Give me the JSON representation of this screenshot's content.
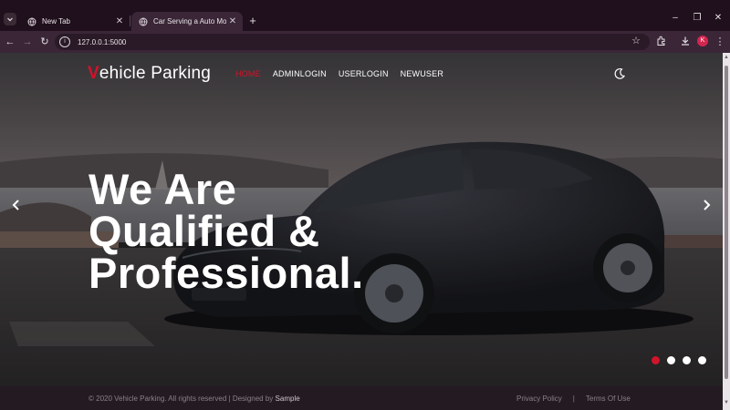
{
  "browser": {
    "tabs": [
      {
        "title": "New Tab",
        "active": false
      },
      {
        "title": "Car Serving a Auto Mobile Cat",
        "active": true
      }
    ],
    "url": "127.0.0.1:5000",
    "profile_initial": "K"
  },
  "site": {
    "brand_first": "V",
    "brand_rest": "ehicle Parking",
    "nav": [
      {
        "label": "HOME",
        "active": true
      },
      {
        "label": "ADMINLOGIN",
        "active": false
      },
      {
        "label": "USERLOGIN",
        "active": false
      },
      {
        "label": "NEWUSER",
        "active": false
      }
    ],
    "hero": {
      "line1": "We Are",
      "line2": "Qualified &",
      "line3": "Professional."
    },
    "carousel": {
      "slides": 4,
      "active_index": 0
    },
    "footer": {
      "copyright": "© 2020 Vehicle Parking. All rights reserved | Designed by",
      "designer": "Sample",
      "links": [
        "Privacy Policy",
        "|",
        "Terms Of Use"
      ]
    }
  },
  "colors": {
    "accent": "#d0142c",
    "tab_bar": "#200f1c",
    "toolbar": "#3a2637"
  },
  "icons": [
    "tab-search-icon",
    "globe-icon",
    "close-icon",
    "plus-icon",
    "minimize-icon",
    "maximize-icon",
    "back-icon",
    "forward-icon",
    "reload-icon",
    "site-info-icon",
    "star-icon",
    "extensions-icon",
    "download-icon",
    "menu-icon",
    "moon-icon",
    "chevron-left-icon",
    "chevron-right-icon"
  ]
}
